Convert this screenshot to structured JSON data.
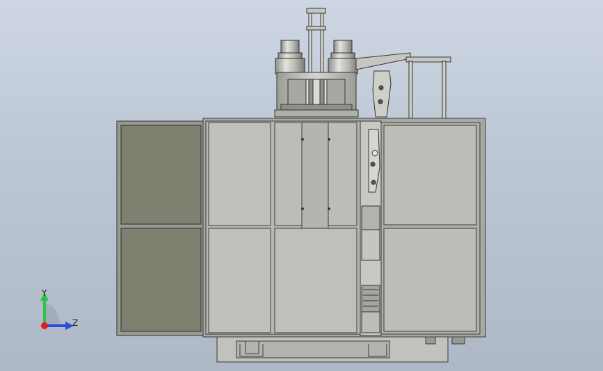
{
  "viewport": {
    "background_top": "#cdd6e2",
    "background_bottom": "#aeb8c6"
  },
  "model": {
    "panel_color": "#bcbcb6",
    "door_color": "#7f8070",
    "frame_color": "#9a9a94",
    "edge_color": "#3a3a3a"
  },
  "triad": {
    "y_label": "Y",
    "z_label": "Z",
    "y_color": "#2bc24a",
    "z_color": "#2a4fd6",
    "x_color": "#e02020"
  }
}
